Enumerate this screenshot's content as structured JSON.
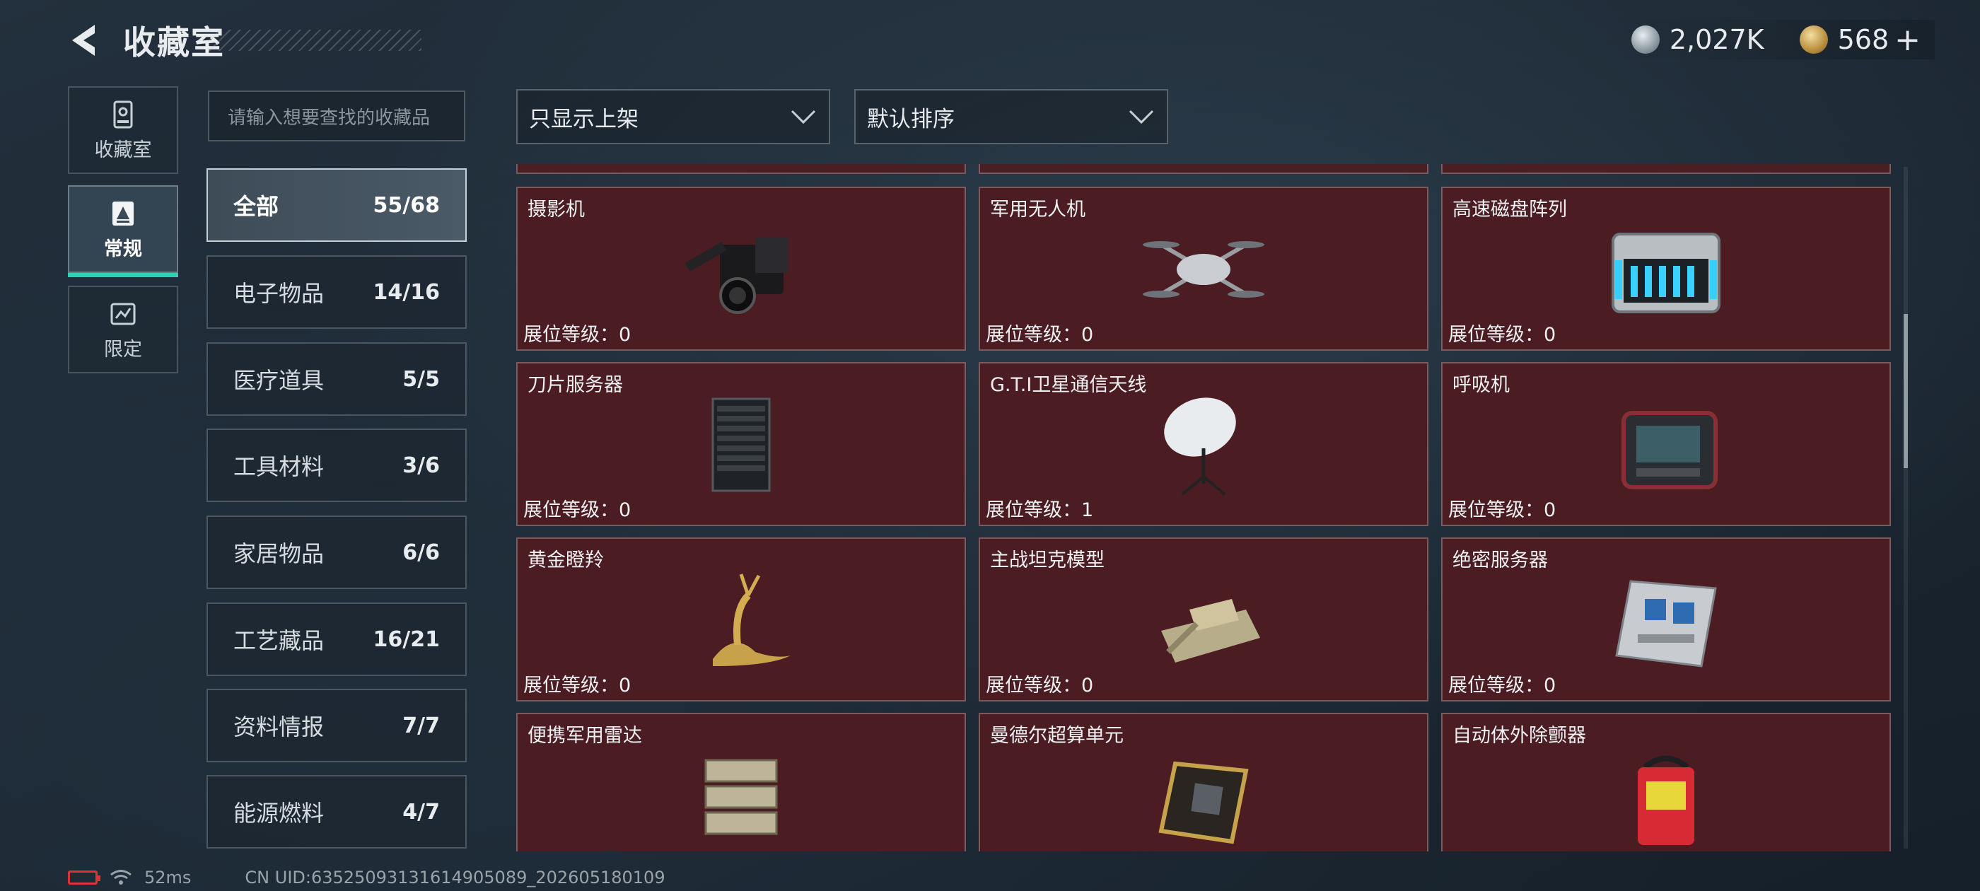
{
  "header": {
    "title": "收藏室"
  },
  "currency": [
    {
      "icon": "silver-coin-icon",
      "value": "2,027K"
    },
    {
      "icon": "gold-coin-icon",
      "value": "568"
    }
  ],
  "currency_plus": "+",
  "side_tabs": [
    {
      "label": "收藏室",
      "icon": "vault-icon",
      "active": false
    },
    {
      "label": "常规",
      "icon": "regular-icon",
      "active": true
    },
    {
      "label": "限定",
      "icon": "limited-icon",
      "active": false
    }
  ],
  "search": {
    "placeholder": "请输入想要查找的收藏品"
  },
  "filters": {
    "shelf": "只显示上架",
    "sort": "默认排序"
  },
  "categories": [
    {
      "name": "全部",
      "count": "55/68",
      "active": true
    },
    {
      "name": "电子物品",
      "count": "14/16"
    },
    {
      "name": "医疗道具",
      "count": "5/5"
    },
    {
      "name": "工具材料",
      "count": "3/6"
    },
    {
      "name": "家居物品",
      "count": "6/6"
    },
    {
      "name": "工艺藏品",
      "count": "16/21"
    },
    {
      "name": "资料情报",
      "count": "7/7"
    },
    {
      "name": "能源燃料",
      "count": "4/7"
    }
  ],
  "level_label": "展位等级：",
  "items": [
    {
      "name": "摄影机",
      "level": "0",
      "icon": "camera-icon"
    },
    {
      "name": "军用无人机",
      "level": "0",
      "icon": "drone-icon"
    },
    {
      "name": "高速磁盘阵列",
      "level": "0",
      "icon": "disk-array-icon"
    },
    {
      "name": "刀片服务器",
      "level": "0",
      "icon": "blade-server-icon"
    },
    {
      "name": "G.T.I卫星通信天线",
      "level": "1",
      "icon": "satellite-dish-icon"
    },
    {
      "name": "呼吸机",
      "level": "0",
      "icon": "ventilator-icon"
    },
    {
      "name": "黄金瞪羚",
      "level": "0",
      "icon": "golden-gazelle-icon"
    },
    {
      "name": "主战坦克模型",
      "level": "0",
      "icon": "tank-model-icon"
    },
    {
      "name": "绝密服务器",
      "level": "0",
      "icon": "secret-server-icon"
    },
    {
      "name": "便携军用雷达",
      "icon": "radar-icon"
    },
    {
      "name": "曼德尔超算单元",
      "icon": "supercomputer-chip-icon"
    },
    {
      "name": "自动体外除颤器",
      "icon": "defibrillator-icon"
    }
  ],
  "footer": {
    "ping": "52ms",
    "uid": "CN UID:6352509313161490508​9_202605180109"
  }
}
